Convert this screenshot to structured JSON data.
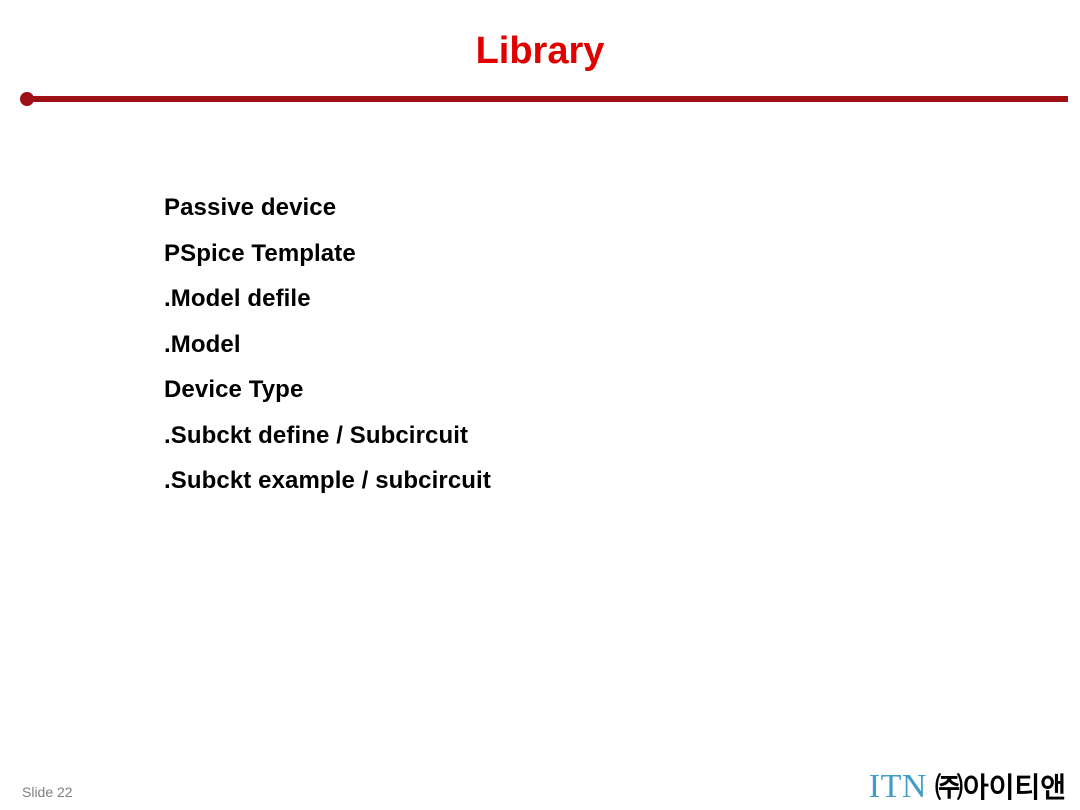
{
  "slide": {
    "title": "Library",
    "accent_color": "#e00000",
    "rule_color": "#9e1016",
    "background_color": "#ffffff"
  },
  "body": {
    "lines": [
      {
        "text": "Passive device"
      },
      {
        "text": "PSpice Template"
      },
      {
        "text": ".Model defile"
      },
      {
        "text": ".Model"
      },
      {
        "text": "Device Type"
      },
      {
        "text": ".Subckt define / Subcircuit"
      },
      {
        "text": ".Subckt example / subcircuit"
      }
    ]
  },
  "footer": {
    "slide_number": "Slide 22",
    "slide_number_color": "#7f7f7f",
    "logo_mark": "ITN",
    "logo_mark_color": "#3f9ec9",
    "logo_name": "㈜아이티앤",
    "logo_name_color": "#000000"
  }
}
